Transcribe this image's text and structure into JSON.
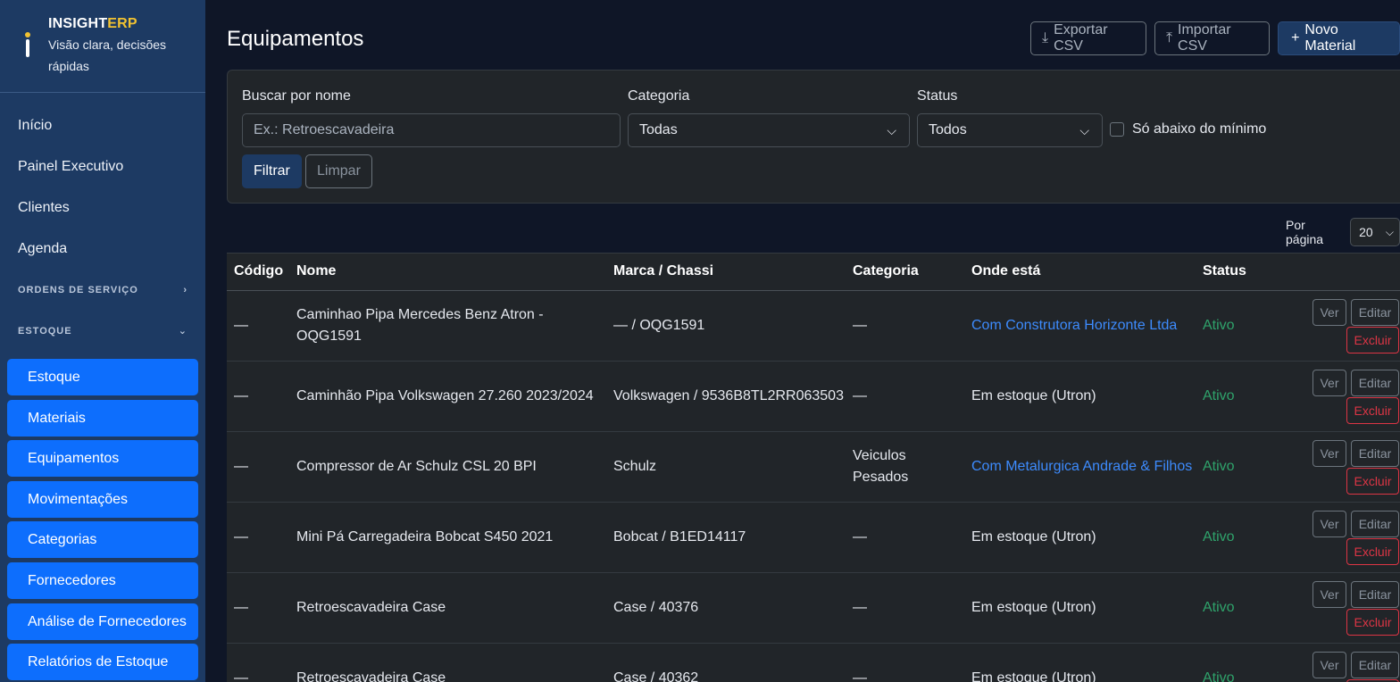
{
  "brand": {
    "name_main": "INSIGHT",
    "name_accent": "ERP",
    "tagline": "Visão clara, decisões rápidas"
  },
  "colors": {
    "sidebar": "#1d3a63",
    "accent": "#f2c231",
    "primary": "#0d6efd",
    "link": "#3d8bfd",
    "success": "#2fa36b",
    "danger": "#dc3545"
  },
  "nav": {
    "items": [
      "Início",
      "Painel Executivo",
      "Clientes",
      "Agenda"
    ],
    "section_os": "ORDENS DE SERVIÇO",
    "section_estoque": "ESTOQUE",
    "sub_items": [
      "Estoque",
      "Materiais",
      "Equipamentos",
      "Movimentações",
      "Categorias",
      "Fornecedores",
      "Análise de Fornecedores",
      "Relatórios de Estoque"
    ]
  },
  "page": {
    "title": "Equipamentos",
    "export_label": "Exportar CSV",
    "import_label": "Importar CSV",
    "new_label": "Novo Material"
  },
  "filters": {
    "search_label": "Buscar por nome",
    "search_placeholder": "Ex.: Retroescavadeira",
    "category_label": "Categoria",
    "category_value": "Todas",
    "status_label": "Status",
    "status_value": "Todos",
    "below_min_label": "Só abaixo do mínimo",
    "filter_button": "Filtrar",
    "clear_button": "Limpar"
  },
  "pagination": {
    "per_page_label": "Por página",
    "per_page_value": "20"
  },
  "table": {
    "headers": [
      "Código",
      "Nome",
      "Marca / Chassi",
      "Categoria",
      "Onde está",
      "Status"
    ],
    "action_labels": {
      "view": "Ver",
      "edit": "Editar",
      "delete": "Excluir"
    },
    "rows": [
      {
        "code": "—",
        "name": "Caminhao Pipa Mercedes Benz Atron - OQG1591",
        "brand": "— / OQG1591",
        "category": "—",
        "location": "Com Construtora Horizonte Ltda",
        "location_link": true,
        "status": "Ativo"
      },
      {
        "code": "—",
        "name": "Caminhão Pipa Volkswagen 27.260 2023/2024",
        "brand": "Volkswagen / 9536B8TL2RR063503",
        "category": "—",
        "location": "Em estoque (Utron)",
        "location_link": false,
        "status": "Ativo"
      },
      {
        "code": "—",
        "name": "Compressor de Ar Schulz CSL 20 BPI",
        "brand": "Schulz",
        "category": "Veiculos Pesados",
        "location": "Com Metalurgica Andrade & Filhos",
        "location_link": true,
        "status": "Ativo"
      },
      {
        "code": "—",
        "name": "Mini Pá Carregadeira Bobcat S450 2021",
        "brand": "Bobcat / B1ED14117",
        "category": "—",
        "location": "Em estoque (Utron)",
        "location_link": false,
        "status": "Ativo"
      },
      {
        "code": "—",
        "name": "Retroescavadeira Case",
        "brand": "Case / 40376",
        "category": "—",
        "location": "Em estoque (Utron)",
        "location_link": false,
        "status": "Ativo"
      },
      {
        "code": "—",
        "name": "Retroescavadeira Case",
        "brand": "Case / 40362",
        "category": "—",
        "location": "Em estoque (Utron)",
        "location_link": false,
        "status": "Ativo"
      }
    ]
  }
}
